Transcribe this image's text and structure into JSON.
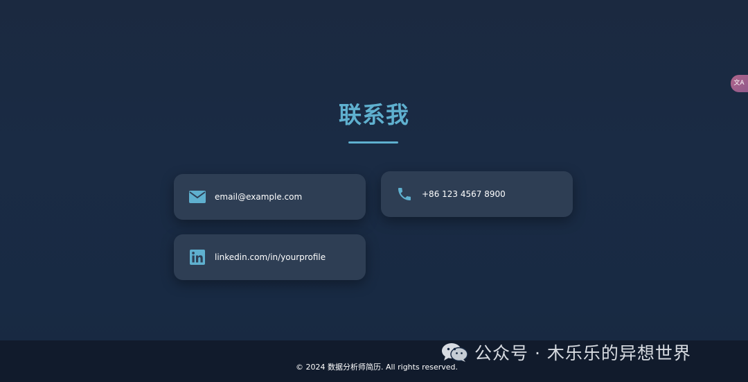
{
  "contact": {
    "title": "联系我",
    "items": [
      {
        "icon": "envelope-icon",
        "label": "email@example.com"
      },
      {
        "icon": "phone-icon",
        "label": "+86 123 4567 8900"
      },
      {
        "icon": "linkedin-icon",
        "label": "linkedin.com/in/yourprofile"
      }
    ]
  },
  "translate_widget": {
    "label": "文A"
  },
  "footer": {
    "copyright": "© 2024 数据分析师简历. All rights reserved."
  },
  "watermark": {
    "icon": "wechat-icon",
    "text": "公众号 · 木乐乐的异想世界"
  },
  "colors": {
    "background": "#1a2b44",
    "accent": "#5fb0cf",
    "card": "#2e3e54",
    "footer": "#111b2c"
  }
}
